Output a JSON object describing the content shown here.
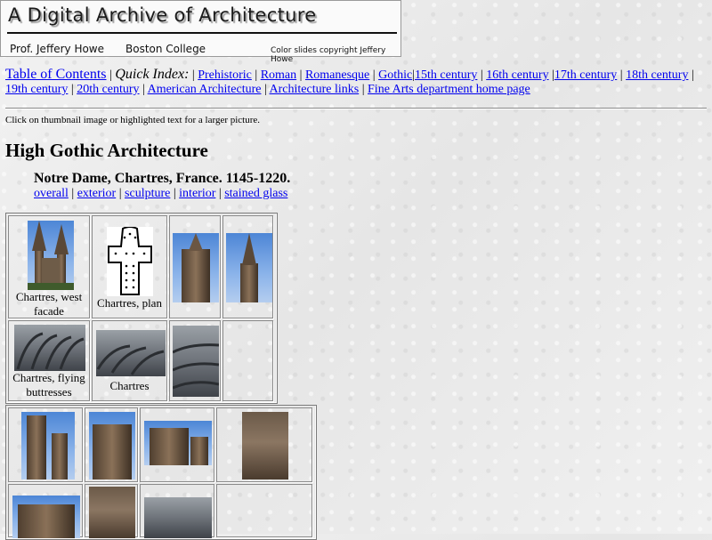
{
  "banner": {
    "title": "A Digital Archive of  Architecture",
    "author": "Prof. Jeffery Howe",
    "college": "Boston College",
    "copyright": "Color slides copyright Jeffery Howe"
  },
  "nav": {
    "toc": "Table of Contents",
    "quick_index": "Quick Index:",
    "links": [
      "Prehistoric",
      "Roman",
      "Romanesque",
      "Gothic",
      "15th century",
      "16th century",
      "17th century",
      "18th century",
      "19th century",
      "20th century",
      "American Architecture",
      "Architecture links",
      "Fine Arts department home page"
    ]
  },
  "instructions": "Click on thumbnail image or highlighted text for a larger picture.",
  "page_title": "High Gothic Architecture",
  "section": {
    "title": "Notre Dame, Chartres, France. 1145-1220.",
    "links": [
      "overall",
      "exterior",
      "sculpture",
      "interior",
      "stained glass"
    ]
  },
  "table1": {
    "row1": [
      "Chartres, west facade",
      "Chartres, plan",
      "",
      ""
    ],
    "row2": [
      "Chartres, flying buttresses",
      "Chartres",
      "",
      ""
    ]
  },
  "colors": {
    "link": "#0000ee",
    "background": "#ededed"
  }
}
